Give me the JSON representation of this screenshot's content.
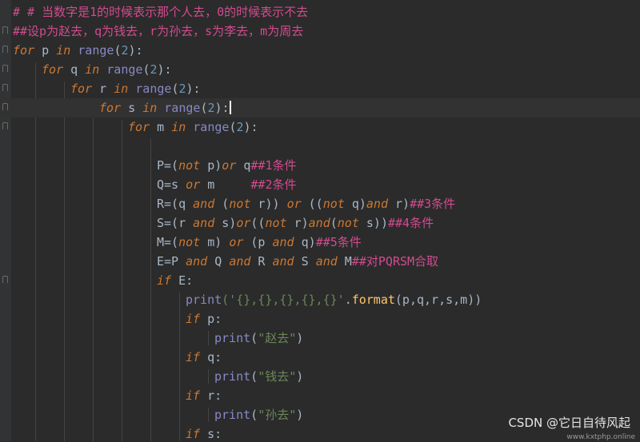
{
  "lines": [
    {
      "text": "# # 当数字是1的时候表示那个人去，0的时候表示不去"
    },
    {
      "text": "##设p为赵去，q为钱去，r为孙去，s为李去，m为周去"
    },
    {
      "t0": "for",
      "t1": "p",
      "t2": "in",
      "t3": "range",
      "t4": "(",
      "t5": "2",
      "t6": "):"
    },
    {
      "t0": "for",
      "t1": "q",
      "t2": "in",
      "t3": "range",
      "t4": "(",
      "t5": "2",
      "t6": "):"
    },
    {
      "t0": "for",
      "t1": "r",
      "t2": "in",
      "t3": "range",
      "t4": "(",
      "t5": "2",
      "t6": "):"
    },
    {
      "t0": "for",
      "t1": "s",
      "t2": "in",
      "t3": "range",
      "t4": "(",
      "t5": "2",
      "t6": "):"
    },
    {
      "t0": "for",
      "t1": "m",
      "t2": "in",
      "t3": "range",
      "t4": "(",
      "t5": "2",
      "t6": "):"
    },
    {},
    {
      "a": "P=(",
      "b": "not",
      "c": " p)",
      "d": "or",
      "e": " q",
      "f": "##1条件"
    },
    {
      "a": "Q=s ",
      "b": "or",
      "c": " m     ",
      "f": "##2条件"
    },
    {
      "a": "R=(q ",
      "b": "and",
      "c": " (",
      "d": "not",
      "e": " r)) ",
      "g": "or",
      "h": " ((",
      "i": "not",
      "j": " q)",
      "k": "and",
      "l": " r)",
      "f": "##3条件"
    },
    {
      "a": "S=(r ",
      "b": "and",
      "c": " s)",
      "d": "or",
      "e": "((",
      "g": "not",
      "h": " r)",
      "i": "and",
      "j": "(",
      "k": "not",
      "l": " s))",
      "f": "##4条件"
    },
    {
      "a": "M=(",
      "b": "not",
      "c": " m) ",
      "d": "or",
      "e": " (p ",
      "g": "and",
      "h": " q)",
      "f": "##5条件"
    },
    {
      "a": "E=P ",
      "b": "and",
      "c": " Q ",
      "d": "and",
      "e": " R ",
      "g": "and",
      "h": " S ",
      "i": "and",
      "j": " M",
      "f": "##对PQRSM合取"
    },
    {
      "a": "if",
      "b": " E:"
    },
    {
      "a": "print",
      "b": "('{},{},{},{},{}'",
      "c": ".",
      "d": "format",
      "e": "(p,q,r,s,m))"
    },
    {
      "a": "if",
      "b": " p:"
    },
    {
      "a": "print",
      "b": "(",
      "c": "\"赵去\"",
      "d": ")"
    },
    {
      "a": "if",
      "b": " q:"
    },
    {
      "a": "print",
      "b": "(",
      "c": "\"钱去\"",
      "d": ")"
    },
    {
      "a": "if",
      "b": " r:"
    },
    {
      "a": "print",
      "b": "(",
      "c": "\"孙去\"",
      "d": ")"
    },
    {
      "a": "if",
      "b": " s:"
    }
  ],
  "watermark": {
    "text": "CSDN @它日自待风起",
    "url": "www.kxtphp.online"
  },
  "colors": {
    "background": "#2b2b2b",
    "keyword": "#cc7832",
    "builtin": "#8888c6",
    "number": "#6897bb",
    "comment": "#d24b8f",
    "string": "#6a8759"
  }
}
